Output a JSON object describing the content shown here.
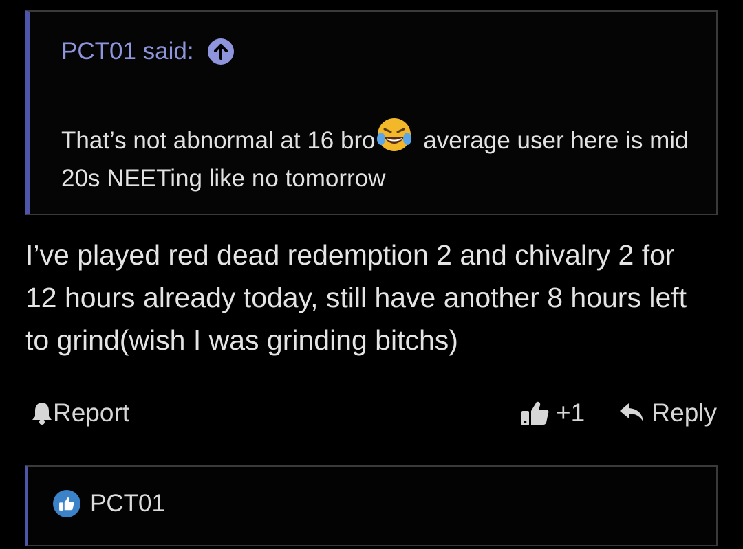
{
  "quote": {
    "author_said": "PCT01 said:",
    "text_before_emoji": "That’s not abnormal at 16 bro",
    "emoji": "joy-emoji",
    "text_after_emoji": " average user here is mid 20s NEETing like no tomorrow"
  },
  "post": {
    "body": "I’ve played red dead redemption 2 and chivalry 2 for 12 hours already today, still have another 8 hours left to grind(wish I was grinding bitchs)"
  },
  "actions": {
    "report_label": "Report",
    "like_count": "+1",
    "reply_label": "Reply"
  },
  "likers": {
    "names": "PCT01"
  },
  "colors": {
    "background": "#000000",
    "accent": "#4d56a8",
    "link": "#8f95dc",
    "like_badge": "#3b82c8"
  }
}
